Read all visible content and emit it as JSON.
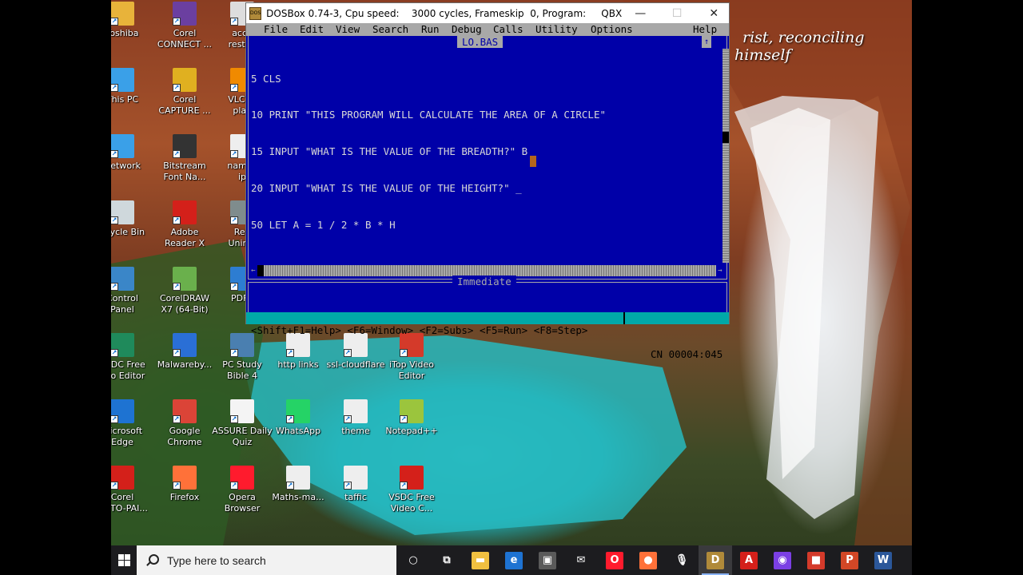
{
  "desktop": {
    "quote_line1": "rist, reconciling",
    "quote_line2": "himself",
    "icons": [
      {
        "label": "Toshiba",
        "icon": "folder-icon",
        "color": "#e8b33a"
      },
      {
        "label": "Corel\nCONNECT ...",
        "icon": "corel-connect-icon",
        "color": "#6b3fa0"
      },
      {
        "label": "acce\nrestric",
        "icon": "shortcut-icon",
        "color": "#dddddd"
      },
      {
        "label": "This PC",
        "icon": "computer-icon",
        "color": "#3aa0e8"
      },
      {
        "label": "Corel\nCAPTURE ...",
        "icon": "corel-capture-icon",
        "color": "#e0b020"
      },
      {
        "label": "VLC m\nplay",
        "icon": "vlc-icon",
        "color": "#f08a00"
      },
      {
        "label": "Network",
        "icon": "network-icon",
        "color": "#3aa0e8"
      },
      {
        "label": "Bitstream\nFont Na...",
        "icon": "bitstream-icon",
        "color": "#333333"
      },
      {
        "label": "namec\nip",
        "icon": "file-icon",
        "color": "#eeeeee"
      },
      {
        "label": "ecycle Bin",
        "icon": "recycle-bin-icon",
        "color": "#cfd8dc"
      },
      {
        "label": "Adobe\nReader X",
        "icon": "adobe-reader-icon",
        "color": "#d4201a"
      },
      {
        "label": "Rev\nUninst",
        "icon": "revo-uninstaller-icon",
        "color": "#7f8c8d"
      },
      {
        "label": "Control\nPanel",
        "icon": "control-panel-icon",
        "color": "#3a86c8"
      },
      {
        "label": "CorelDRAW\nX7 (64-Bit)",
        "icon": "coreldraw-icon",
        "color": "#6ab04c"
      },
      {
        "label": "PDFT",
        "icon": "pdf-icon",
        "color": "#2d7dd2"
      },
      {
        "label": "VSDC Free\ndeo Editor",
        "icon": "vsdc-icon",
        "color": "#1f8a5b"
      },
      {
        "label": "Malwareby...",
        "icon": "malwarebytes-icon",
        "color": "#2a6fd6"
      },
      {
        "label": "PC Study\nBible 4",
        "icon": "pc-study-bible-icon",
        "color": "#4a7fb0"
      },
      {
        "label": "http links",
        "icon": "file-icon",
        "color": "#eeeeee"
      },
      {
        "label": "ssl-cloudflare",
        "icon": "file-icon",
        "color": "#eeeeee"
      },
      {
        "label": "iTop Video\nEditor",
        "icon": "itop-icon",
        "color": "#d43a2a"
      },
      {
        "label": "Microsoft\nEdge",
        "icon": "edge-icon",
        "color": "#1e73d2"
      },
      {
        "label": "Google\nChrome",
        "icon": "chrome-icon",
        "color": "#db4437"
      },
      {
        "label": "ASSURE Daily\nQuiz",
        "icon": "document-icon",
        "color": "#f4f4f4"
      },
      {
        "label": "WhatsApp",
        "icon": "whatsapp-icon",
        "color": "#25d366"
      },
      {
        "label": "theme",
        "icon": "file-icon",
        "color": "#eeeeee"
      },
      {
        "label": "Notepad++",
        "icon": "notepadpp-icon",
        "color": "#9bc53d"
      },
      {
        "label": "Corel\nHOTO-PAI...",
        "icon": "corel-photopaint-icon",
        "color": "#d4201a"
      },
      {
        "label": "Firefox",
        "icon": "firefox-icon",
        "color": "#ff7139"
      },
      {
        "label": "Opera\nBrowser",
        "icon": "opera-icon",
        "color": "#ff1b2d"
      },
      {
        "label": "Maths-ma...",
        "icon": "file-icon",
        "color": "#eeeeee"
      },
      {
        "label": "taffic",
        "icon": "file-icon",
        "color": "#eeeeee"
      },
      {
        "label": "VSDC Free\nVideo C...",
        "icon": "vsdc-converter-icon",
        "color": "#d4201a"
      }
    ]
  },
  "dosbox": {
    "title": "DOSBox 0.74-3, Cpu speed:    3000 cycles, Frameskip  0, Program:     QBX",
    "app_icon_text": "DOS",
    "minimize": "—",
    "maximize": "☐",
    "close": "✕",
    "menu": [
      "File",
      "Edit",
      "View",
      "Search",
      "Run",
      "Debug",
      "Calls",
      "Utility",
      "Options"
    ],
    "help": "Help",
    "file_name": "LO.BAS",
    "up_arrow": "↑",
    "code_lines": [
      "5 CLS",
      "10 PRINT \"THIS PROGRAM WILL CALCULATE THE AREA OF A CIRCLE\"",
      "15 INPUT \"WHAT IS THE VALUE OF THE BREADTH?\" B",
      "20 INPUT \"WHAT IS THE VALUE OF THE HEIGHT?\" _",
      "50 LET A = 1 / 2 * B * H"
    ],
    "immediate_title": "Immediate",
    "status_keys": "<Shift+F1=Help> <F6=Window> <F2=Subs> <F5=Run> <F8=Step>",
    "status_pos": "CN 00004:045",
    "hscroll_left": "←",
    "hscroll_right": "→"
  },
  "taskbar": {
    "search_placeholder": "Type here to search",
    "items": [
      {
        "icon": "task-view-cortana-icon",
        "glyph": "○",
        "color": "#1c1c1f"
      },
      {
        "icon": "task-view-icon",
        "glyph": "⧉",
        "color": "#1c1c1f"
      },
      {
        "icon": "file-explorer-icon",
        "glyph": "▬",
        "color": "#f0c040"
      },
      {
        "icon": "edge-icon",
        "glyph": "e",
        "color": "#1e73d2"
      },
      {
        "icon": "store-icon",
        "glyph": "▣",
        "color": "#5a5a5a"
      },
      {
        "icon": "mail-icon",
        "glyph": "✉",
        "color": "#1c1c1f"
      },
      {
        "icon": "opera-icon",
        "glyph": "O",
        "color": "#ff1b2d"
      },
      {
        "icon": "firefox-icon",
        "glyph": "●",
        "color": "#ff7139"
      },
      {
        "icon": "microphone-icon",
        "glyph": "🎙",
        "color": "#1c1c1f"
      },
      {
        "icon": "dosbox-icon",
        "glyph": "D",
        "color": "#b08a3a"
      },
      {
        "icon": "adobe-reader-icon",
        "glyph": "A",
        "color": "#d4201a"
      },
      {
        "icon": "record-icon",
        "glyph": "◉",
        "color": "#7b3fe4"
      },
      {
        "icon": "camera-icon",
        "glyph": "■",
        "color": "#d43a2a"
      },
      {
        "icon": "powerpoint-icon",
        "glyph": "P",
        "color": "#d24726"
      },
      {
        "icon": "word-icon",
        "glyph": "W",
        "color": "#2b579a"
      }
    ]
  }
}
